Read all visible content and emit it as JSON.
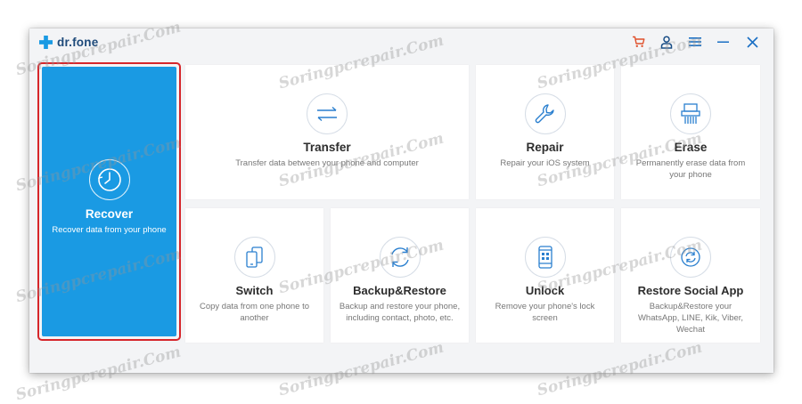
{
  "app": {
    "brand": "dr.fone"
  },
  "titlebar": {
    "icons": [
      "cart-icon",
      "user-icon",
      "menu-icon",
      "minimize-icon",
      "close-icon"
    ],
    "cart_color": "#e0502b",
    "icon_color": "#1a6fc4"
  },
  "tiles": [
    {
      "id": "recover",
      "title": "Recover",
      "description": "Recover data from your phone",
      "icon": "clock-icon",
      "highlighted": true
    },
    {
      "id": "transfer",
      "title": "Transfer",
      "description": "Transfer data between your phone and computer",
      "icon": "transfer-arrows-icon"
    },
    {
      "id": "repair",
      "title": "Repair",
      "description": "Repair your iOS system",
      "icon": "wrench-icon"
    },
    {
      "id": "erase",
      "title": "Erase",
      "description_line1": "Permanently erase data from",
      "description_line2": "your phone",
      "icon": "shredder-icon"
    },
    {
      "id": "switch",
      "title": "Switch",
      "description_line1": "Copy data from one phone to",
      "description_line2": "another",
      "icon": "phones-icon"
    },
    {
      "id": "backup",
      "title": "Backup&Restore",
      "description_line1": "Backup and restore your phone,",
      "description_line2": "including contact, photo, etc.",
      "icon": "sync-icon"
    },
    {
      "id": "unlock",
      "title": "Unlock",
      "description_line1": "Remove your phone's lock",
      "description_line2": "screen",
      "icon": "phone-lock-icon"
    },
    {
      "id": "social",
      "title": "Restore Social App",
      "description_line1": "Backup&Restore your",
      "description_line2": "WhatsApp, LINE, Kik, Viber,",
      "description_line3": "Wechat",
      "icon": "social-restore-icon"
    }
  ],
  "colors": {
    "accent": "#1a9ae3",
    "highlight_border": "#d6262b"
  },
  "watermark": "Soringpcrepair.Com"
}
